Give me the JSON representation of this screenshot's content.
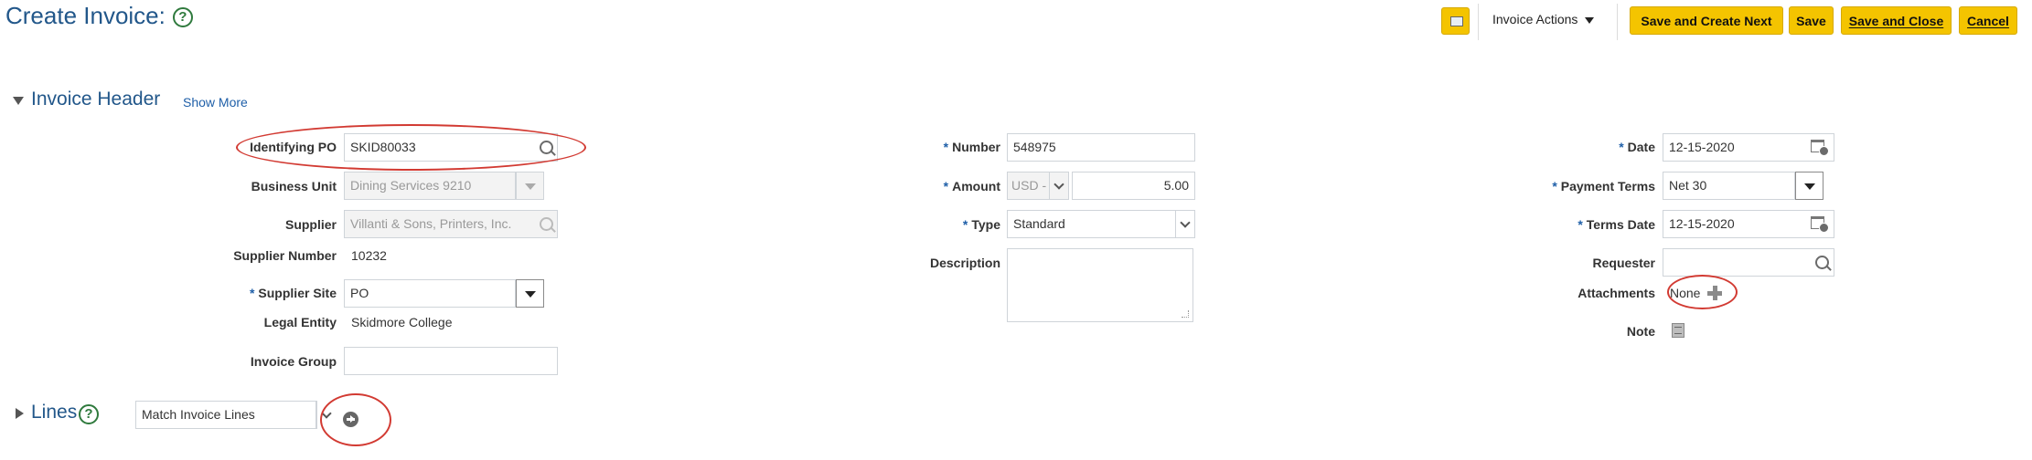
{
  "page": {
    "title": "Create Invoice:"
  },
  "toolbar": {
    "actions_label": "Invoice Actions",
    "save_create_next": "Save and Create Next",
    "save": "Save",
    "save_close": "Save and Close",
    "cancel": "Cancel"
  },
  "header": {
    "title": "Invoice Header",
    "show_more": "Show More",
    "identifying_po": {
      "label": "Identifying PO",
      "value": "SKID80033"
    },
    "business_unit": {
      "label": "Business Unit",
      "value": "Dining Services 9210"
    },
    "supplier": {
      "label": "Supplier",
      "value": "Villanti & Sons, Printers, Inc."
    },
    "supplier_number": {
      "label": "Supplier Number",
      "value": "10232"
    },
    "supplier_site": {
      "label": "Supplier Site",
      "value": "PO"
    },
    "legal_entity": {
      "label": "Legal Entity",
      "value": "Skidmore College"
    },
    "invoice_group": {
      "label": "Invoice Group",
      "value": ""
    },
    "number": {
      "label": "Number",
      "value": "548975"
    },
    "amount": {
      "label": "Amount",
      "currency": "USD -",
      "value": "5.00"
    },
    "type": {
      "label": "Type",
      "value": "Standard"
    },
    "description": {
      "label": "Description",
      "value": ""
    },
    "date": {
      "label": "Date",
      "value": "12-15-2020"
    },
    "payment_terms": {
      "label": "Payment Terms",
      "value": "Net 30"
    },
    "terms_date": {
      "label": "Terms Date",
      "value": "12-15-2020"
    },
    "requester": {
      "label": "Requester",
      "value": ""
    },
    "attachments": {
      "label": "Attachments",
      "value": "None"
    },
    "note": {
      "label": "Note"
    },
    "required_mark": "*"
  },
  "lines": {
    "title": "Lines",
    "match_value": "Match Invoice Lines"
  },
  "icons": {
    "help": "help-circle-icon",
    "search": "magnifier-icon",
    "calendar": "calendar-icon",
    "add": "plus-icon",
    "note": "note-icon",
    "go": "go-arrow-icon"
  },
  "colors": {
    "button_yellow": "#f4c400",
    "title_blue": "#22578a",
    "annotation_red": "#d23a32"
  }
}
